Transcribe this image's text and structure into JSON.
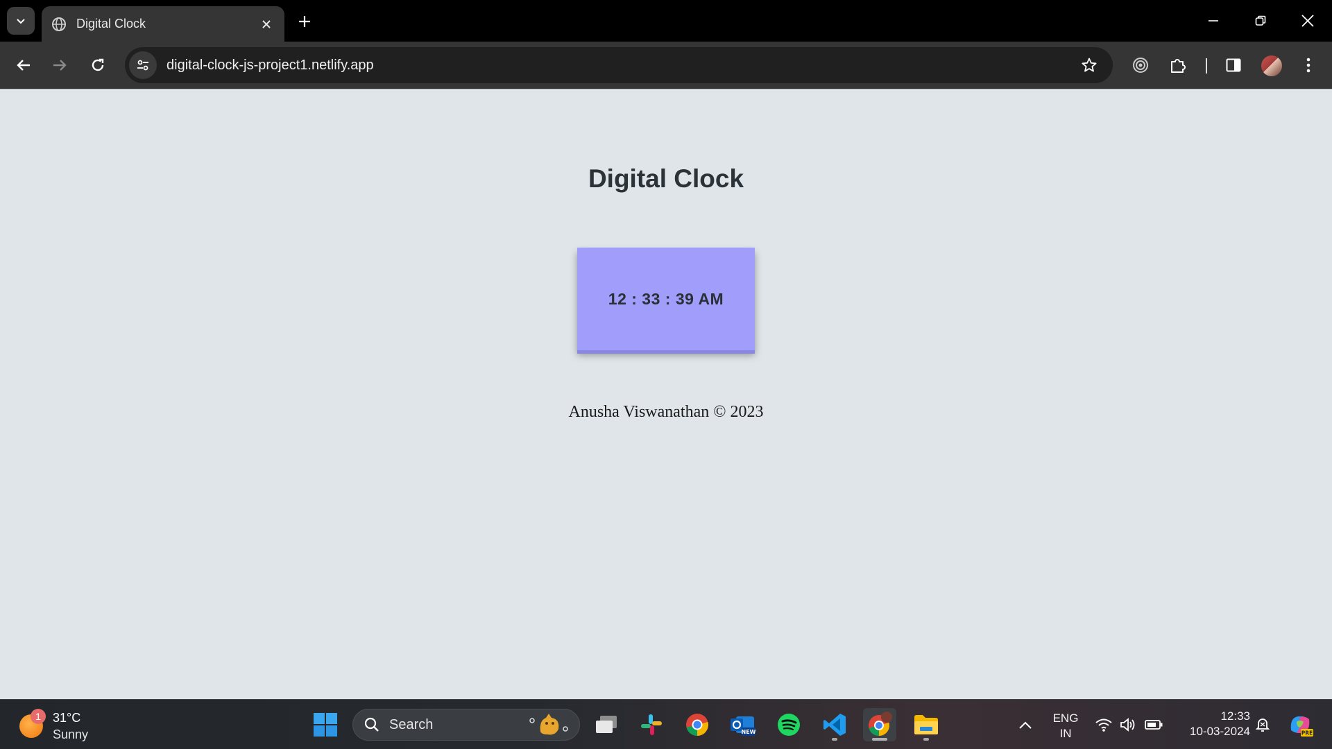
{
  "browser": {
    "tab_title": "Digital Clock",
    "url": "digital-clock-js-project1.netlify.app"
  },
  "page": {
    "title": "Digital Clock",
    "clock_time": "12 : 33 : 39 AM",
    "footer": "Anusha Viswanathan © 2023"
  },
  "taskbar": {
    "weather_temp": "31°C",
    "weather_condition": "Sunny",
    "weather_badge": "1",
    "search_label": "Search",
    "lang_line1": "ENG",
    "lang_line2": "IN",
    "time": "12:33",
    "date": "10-03-2024"
  },
  "colors": {
    "page_bg": "#dfe5e8",
    "clock_box": "#a09dfb",
    "chrome_toolbar": "#353535",
    "chrome_tabstrip": "#000000"
  }
}
